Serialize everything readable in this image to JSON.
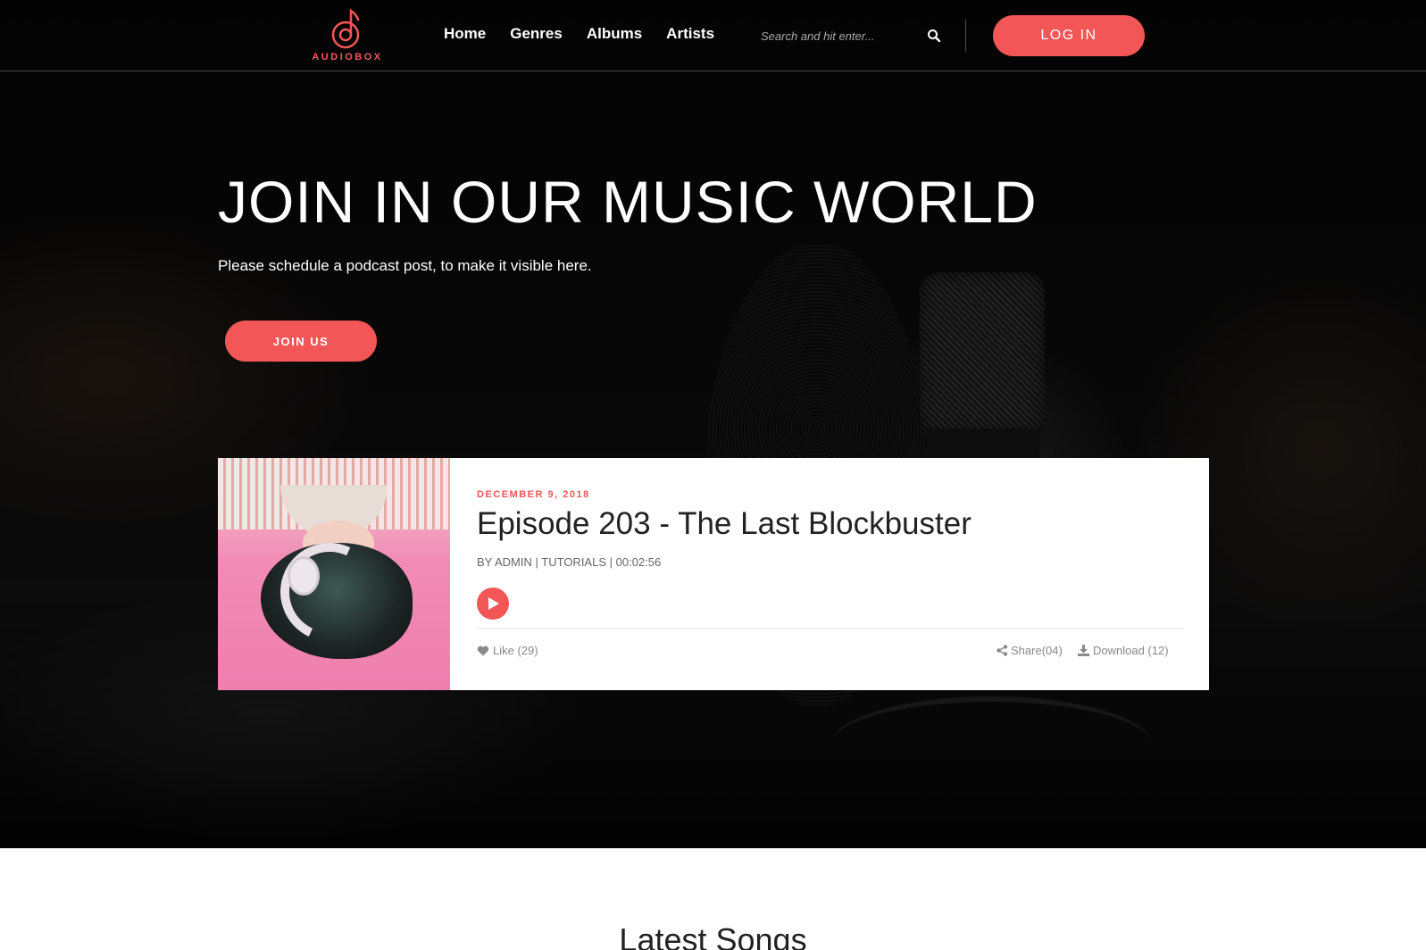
{
  "brand": {
    "name": "AUDIOBOX",
    "accent": "#f25656"
  },
  "nav": {
    "items": [
      "Home",
      "Genres",
      "Albums",
      "Artists"
    ]
  },
  "search": {
    "placeholder": "Search and hit enter...",
    "icon": "search-icon"
  },
  "header": {
    "login_label": "LOG IN"
  },
  "hero": {
    "title": "JOIN IN OUR MUSIC WORLD",
    "subtitle": "Please schedule a podcast post, to make it visible here.",
    "cta_label": "JOIN US"
  },
  "podcast": {
    "date": "DECEMBER 9, 2018",
    "title": "Episode 203 - The Last Blockbuster",
    "author": "BY ADMIN",
    "category": "TUTORIALS",
    "duration": "00:02:56",
    "like_label": "Like (29)",
    "share_label": "Share(04)",
    "download_label": "Download (12)"
  },
  "latest": {
    "title": "Latest Songs"
  }
}
